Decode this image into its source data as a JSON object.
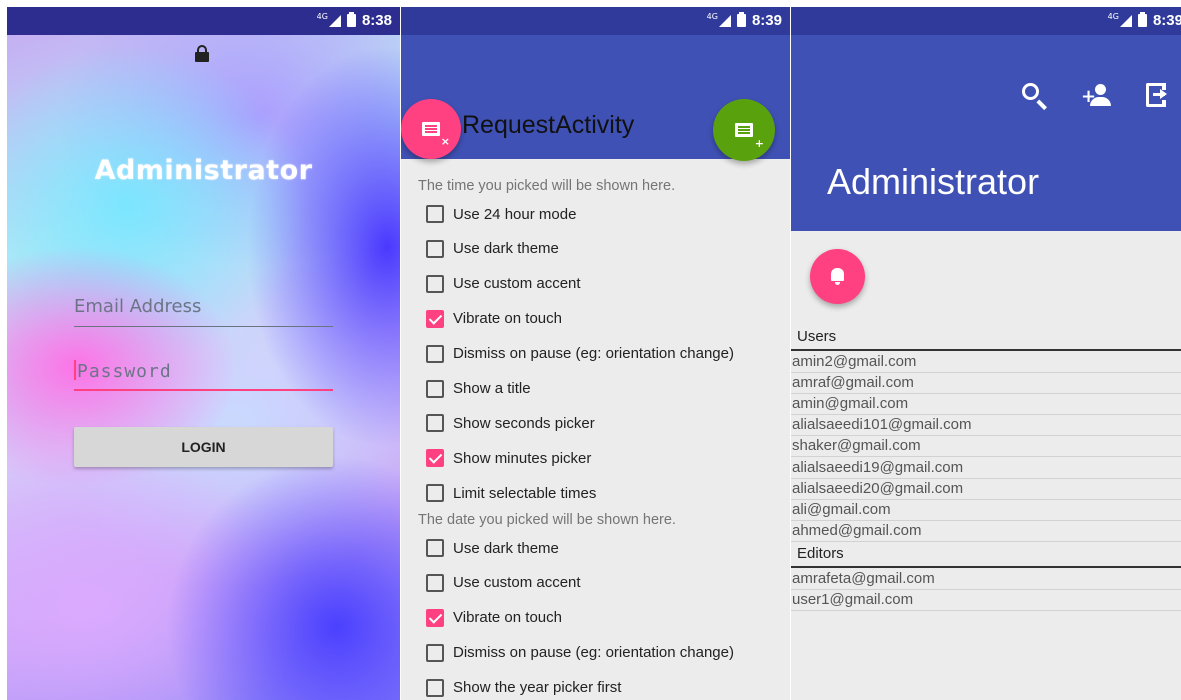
{
  "login_screen": {
    "status": {
      "network": "4G",
      "time": "8:38"
    },
    "title": "Administrator",
    "email_placeholder": "Email Address",
    "password_placeholder": "Password",
    "login_button": "LOGIN",
    "icons": {
      "lock": "lock-icon"
    }
  },
  "request_screen": {
    "status": {
      "network": "4G",
      "time": "8:39"
    },
    "title": "RequestActivity",
    "time_hint": "The time you picked will be shown here.",
    "time_options": [
      {
        "label": "Use 24 hour mode",
        "checked": false
      },
      {
        "label": "Use dark theme",
        "checked": false
      },
      {
        "label": "Use custom accent",
        "checked": false
      },
      {
        "label": "Vibrate on touch",
        "checked": true
      },
      {
        "label": "Dismiss on pause (eg: orientation change)",
        "checked": false
      },
      {
        "label": "Show a title",
        "checked": false
      },
      {
        "label": "Show seconds picker",
        "checked": false
      },
      {
        "label": "Show minutes picker",
        "checked": true
      },
      {
        "label": "Limit selectable times",
        "checked": false
      }
    ],
    "date_hint": "The date you picked will be shown here.",
    "date_options": [
      {
        "label": "Use dark theme",
        "checked": false
      },
      {
        "label": "Use custom accent",
        "checked": false
      },
      {
        "label": "Vibrate on touch",
        "checked": true
      },
      {
        "label": "Dismiss on pause (eg: orientation change)",
        "checked": false
      },
      {
        "label": "Show the year picker first",
        "checked": false
      }
    ],
    "colors": {
      "accent": "#ff4081",
      "primary": "#3f51b5",
      "fab_green": "#5aa10e"
    }
  },
  "admin_screen": {
    "status": {
      "network": "4G",
      "time": "8:39"
    },
    "title": "Administrator",
    "groups": [
      {
        "name": "Users",
        "emails": [
          "amin2@gmail.com",
          "amraf@gmail.com",
          "amin@gmail.com",
          "alialsaeedi101@gmail.com",
          "shaker@gmail.com",
          "alialsaeedi19@gmail.com",
          "alialsaeedi20@gmail.com",
          "ali@gmail.com",
          "ahmed@gmail.com"
        ]
      },
      {
        "name": "Editors",
        "emails": [
          "amrafeta@gmail.com",
          "user1@gmail.com"
        ]
      }
    ],
    "icons": [
      "search-icon",
      "add-user-icon",
      "exit-icon",
      "bell-icon"
    ]
  }
}
